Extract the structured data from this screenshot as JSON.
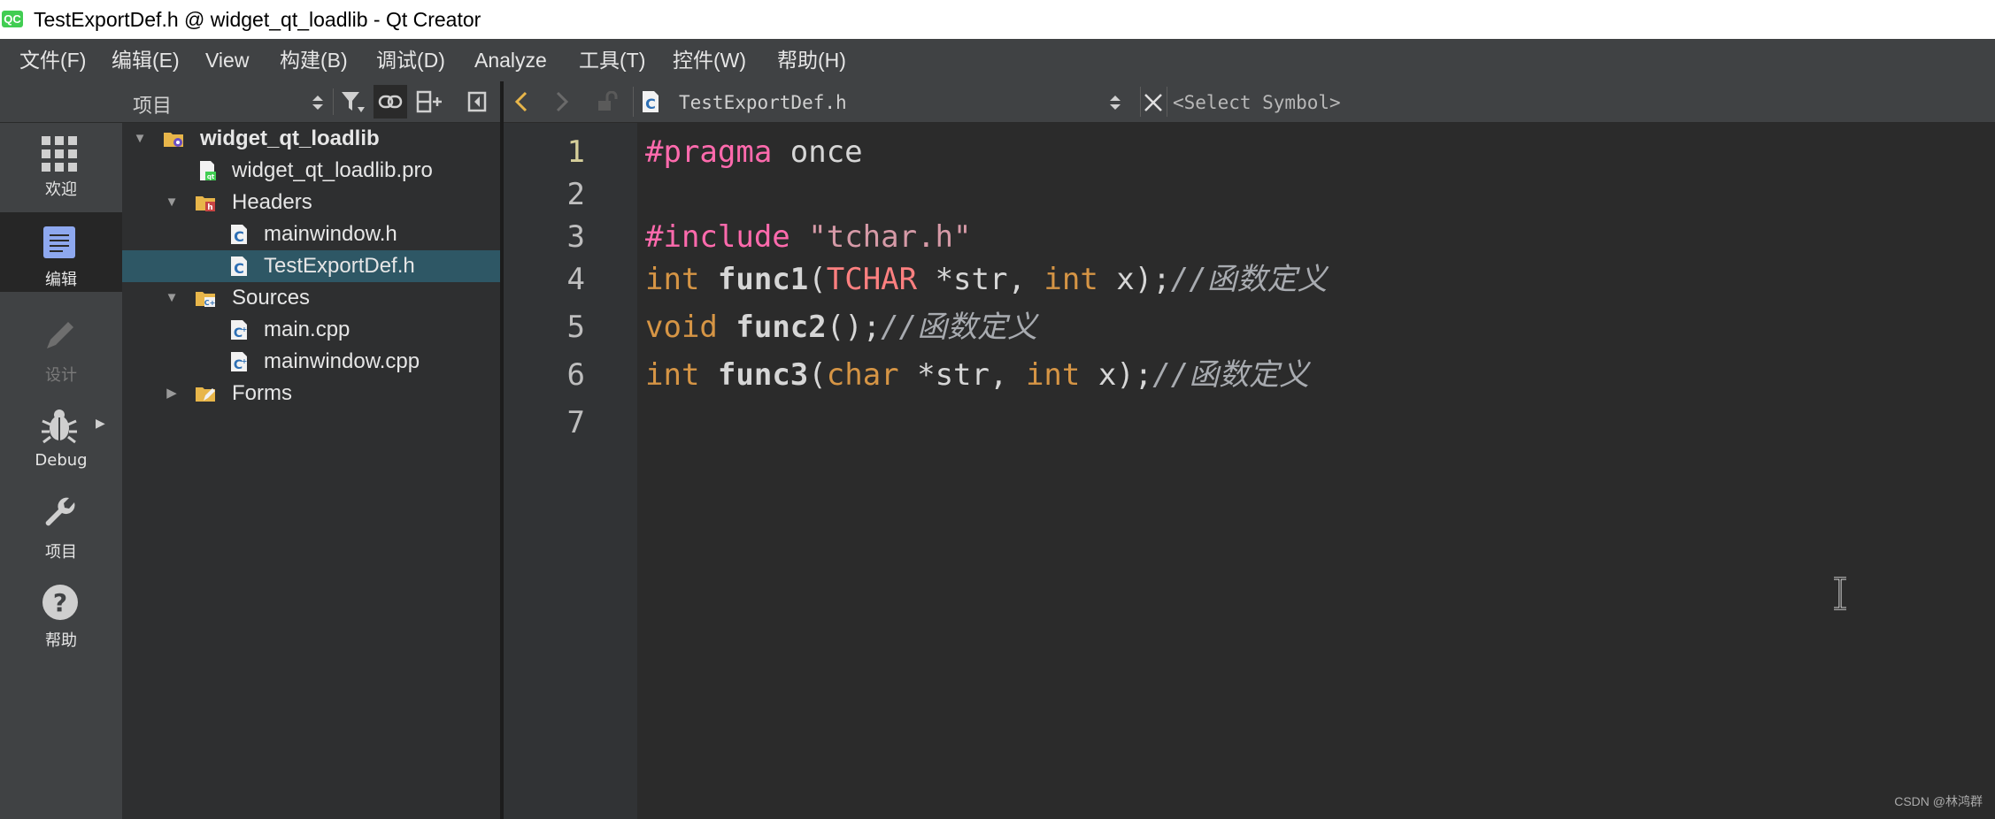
{
  "window": {
    "title": "TestExportDef.h @ widget_qt_loadlib - Qt Creator",
    "app_icon": "QC"
  },
  "menu": [
    "文件(F)",
    "编辑(E)",
    "View",
    "构建(B)",
    "调试(D)",
    "Analyze",
    "工具(T)",
    "控件(W)",
    "帮助(H)"
  ],
  "modes": [
    {
      "icon": "grid-icon",
      "label": "欢迎"
    },
    {
      "icon": "document-edit-icon",
      "label": "编辑"
    },
    {
      "icon": "pencil-icon",
      "label": "设计"
    },
    {
      "icon": "bug-icon",
      "label": "Debug"
    },
    {
      "icon": "wrench-icon",
      "label": "项目"
    },
    {
      "icon": "help-icon",
      "label": "帮助"
    }
  ],
  "project_panel": {
    "view_selector": "项目"
  },
  "tree": [
    {
      "label": "widget_qt_loadlib",
      "type": "project"
    },
    {
      "label": "widget_qt_loadlib.pro",
      "type": "pro-file"
    },
    {
      "label": "Headers",
      "type": "folder-headers"
    },
    {
      "label": "mainwindow.h",
      "type": "header-file"
    },
    {
      "label": "TestExportDef.h",
      "type": "header-file"
    },
    {
      "label": "Sources",
      "type": "folder-sources"
    },
    {
      "label": "main.cpp",
      "type": "source-file"
    },
    {
      "label": "mainwindow.cpp",
      "type": "source-file"
    },
    {
      "label": "Forms",
      "type": "folder-forms"
    }
  ],
  "editor": {
    "file_name": "TestExportDef.h",
    "symbol_selector": "<Select Symbol>",
    "line_numbers": [
      "1",
      "2",
      "3",
      "4",
      "5",
      "6",
      "7"
    ],
    "code": {
      "l1": {
        "a": "#pragma",
        "b": " once"
      },
      "l3": {
        "a": "#include",
        "b": " ",
        "c": "\"tchar.h\""
      },
      "l4": {
        "a": "int",
        "b": " ",
        "c": "func1",
        "d": "(",
        "e": "TCHAR",
        "f": " *str, ",
        "g": "int",
        "h": " x);",
        "i": "//函数定义"
      },
      "l5": {
        "a": "void",
        "b": " ",
        "c": "func2",
        "d": "();",
        "e": "//函数定义"
      },
      "l6": {
        "a": "int",
        "b": " ",
        "c": "func3",
        "d": "(",
        "e": "char",
        "f": " *str, ",
        "g": "int",
        "h": " x);",
        "i": "//函数定义"
      }
    }
  },
  "watermark": "CSDN @林鸿群",
  "colors": {
    "selection": "#2e5765",
    "pragma": "#ff6aad",
    "keyword": "#d69545",
    "current_line_number": "#d6cf9a"
  }
}
